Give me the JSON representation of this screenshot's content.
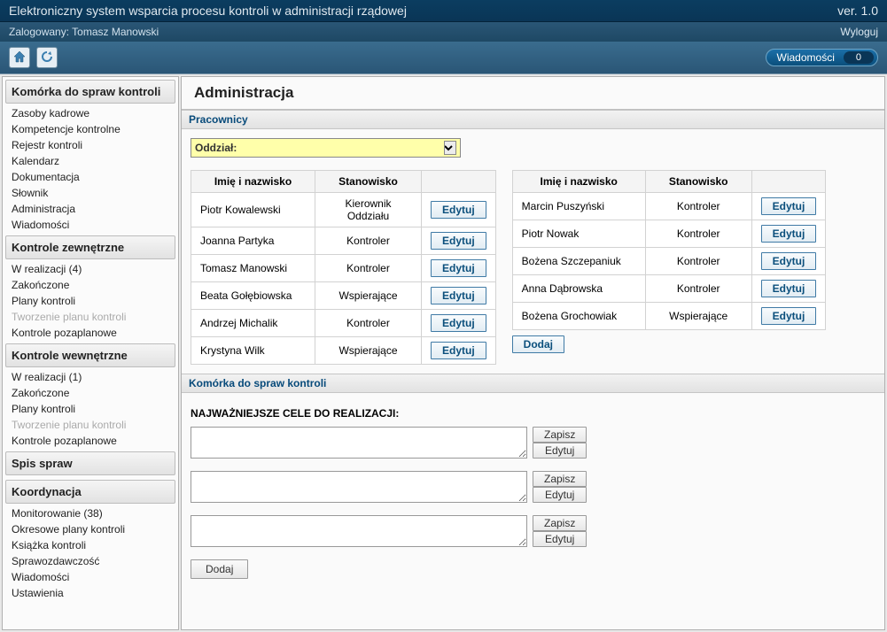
{
  "header": {
    "title": "Elektroniczny system wsparcia procesu kontroli w administracji rządowej",
    "version": "ver. 1.0"
  },
  "subheader": {
    "logged_in": "Zalogowany: Tomasz Manowski",
    "logout": "Wyloguj"
  },
  "toolbar": {
    "messages_label": "Wiadomości",
    "messages_count": "0"
  },
  "sidebar": {
    "sections": [
      {
        "title": "Komórka do spraw kontroli",
        "items": [
          {
            "label": "Zasoby kadrowe",
            "disabled": false
          },
          {
            "label": "Kompetencje kontrolne",
            "disabled": false
          },
          {
            "label": "Rejestr kontroli",
            "disabled": false
          },
          {
            "label": "Kalendarz",
            "disabled": false
          },
          {
            "label": "Dokumentacja",
            "disabled": false
          },
          {
            "label": "Słownik",
            "disabled": false
          },
          {
            "label": "Administracja",
            "disabled": false
          },
          {
            "label": "Wiadomości",
            "disabled": false
          }
        ]
      },
      {
        "title": "Kontrole zewnętrzne",
        "items": [
          {
            "label": "W realizacji (4)",
            "disabled": false
          },
          {
            "label": "Zakończone",
            "disabled": false
          },
          {
            "label": "Plany kontroli",
            "disabled": false
          },
          {
            "label": "Tworzenie planu kontroli",
            "disabled": true
          },
          {
            "label": "Kontrole pozaplanowe",
            "disabled": false
          }
        ]
      },
      {
        "title": "Kontrole wewnętrzne",
        "items": [
          {
            "label": "W realizacji (1)",
            "disabled": false
          },
          {
            "label": "Zakończone",
            "disabled": false
          },
          {
            "label": "Plany kontroli",
            "disabled": false
          },
          {
            "label": "Tworzenie planu kontroli",
            "disabled": true
          },
          {
            "label": "Kontrole pozaplanowe",
            "disabled": false
          }
        ]
      },
      {
        "title": "Spis spraw",
        "items": []
      },
      {
        "title": "Koordynacja",
        "items": [
          {
            "label": "Monitorowanie (38)",
            "disabled": false
          },
          {
            "label": "Okresowe plany kontroli",
            "disabled": false
          },
          {
            "label": "Książka kontroli",
            "disabled": false
          },
          {
            "label": "Sprawozdawczość",
            "disabled": false
          },
          {
            "label": "Wiadomości",
            "disabled": false
          },
          {
            "label": "Ustawienia",
            "disabled": false
          }
        ]
      }
    ]
  },
  "main": {
    "title": "Administracja",
    "employees_panel": "Pracownicy",
    "oddzial_label": "Oddział:",
    "table_headers": {
      "name": "Imię i nazwisko",
      "position": "Stanowisko",
      "action": ""
    },
    "left_table": [
      {
        "name": "Piotr Kowalewski",
        "position": "Kierownik Oddziału"
      },
      {
        "name": "Joanna Partyka",
        "position": "Kontroler"
      },
      {
        "name": "Tomasz Manowski",
        "position": "Kontroler"
      },
      {
        "name": "Beata Gołębiowska",
        "position": "Wspierające"
      },
      {
        "name": "Andrzej Michalik",
        "position": "Kontroler"
      },
      {
        "name": "Krystyna Wilk",
        "position": "Wspierające"
      }
    ],
    "right_table": [
      {
        "name": "Marcin Puszyński",
        "position": "Kontroler"
      },
      {
        "name": "Piotr Nowak",
        "position": "Kontroler"
      },
      {
        "name": "Bożena Szczepaniuk",
        "position": "Kontroler"
      },
      {
        "name": "Anna Dąbrowska",
        "position": "Kontroler"
      },
      {
        "name": "Bożena Grochowiak",
        "position": "Wspierające"
      }
    ],
    "edit_label": "Edytuj",
    "add_label": "Dodaj",
    "cell_panel": "Komórka do spraw kontroli",
    "goals_label": "NAJWAŻNIEJSZE CELE DO REALIZACJI:",
    "save_label": "Zapisz",
    "goal_count": 3
  }
}
